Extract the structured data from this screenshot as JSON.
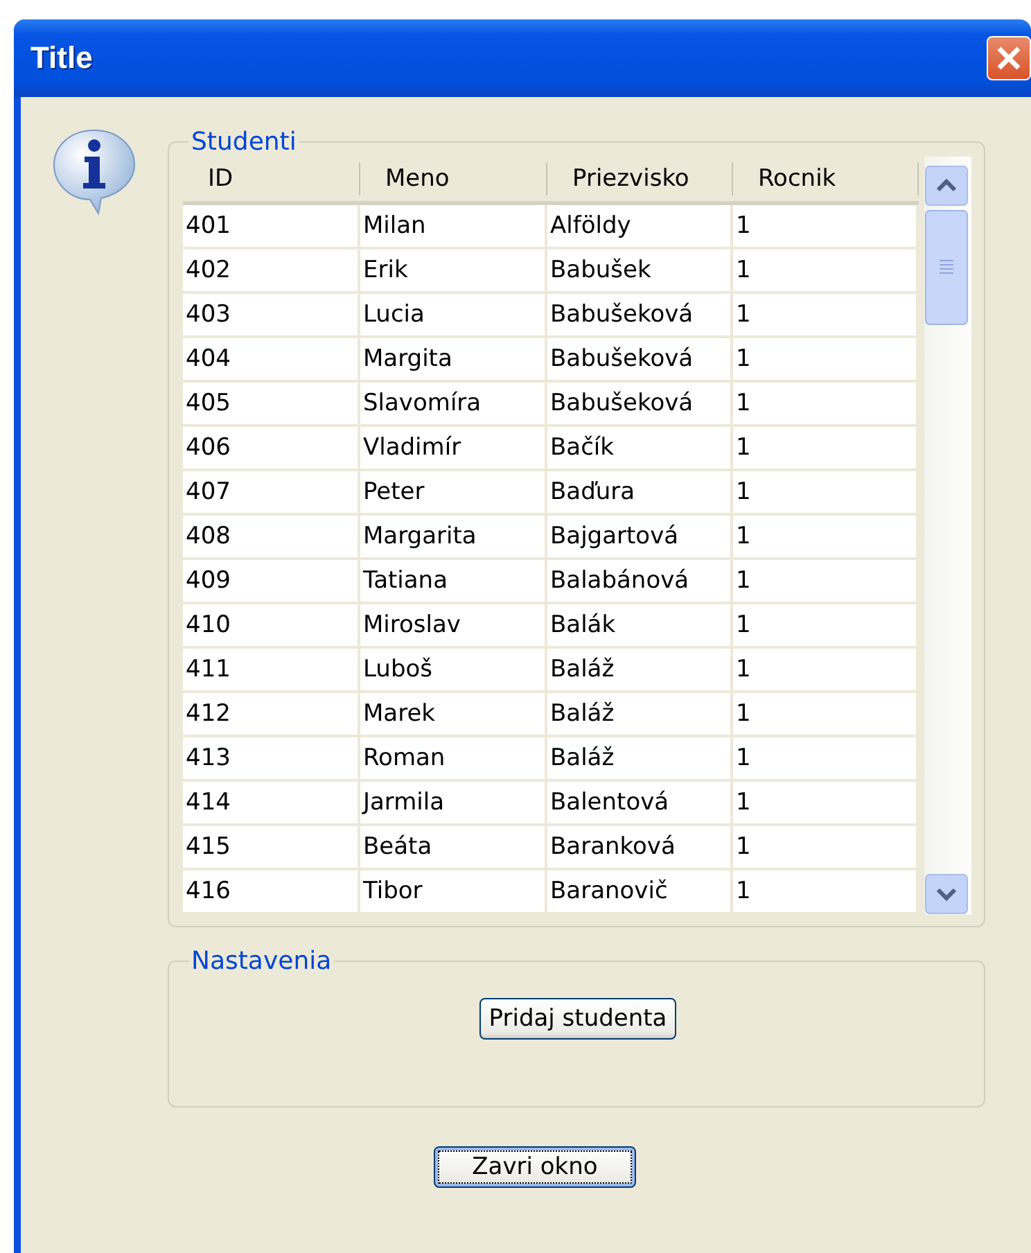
{
  "window": {
    "title": "Title"
  },
  "studenti": {
    "legend": "Studenti",
    "columns": [
      "ID",
      "Meno",
      "Priezvisko",
      "Rocnik"
    ],
    "rows": [
      [
        "401",
        "Milan",
        "Alföldy",
        "1"
      ],
      [
        "402",
        "Erik",
        "Babušek",
        "1"
      ],
      [
        "403",
        "Lucia",
        "Babušeková",
        "1"
      ],
      [
        "404",
        "Margita",
        "Babušeková",
        "1"
      ],
      [
        "405",
        "Slavomíra",
        "Babušeková",
        "1"
      ],
      [
        "406",
        "Vladimír",
        "Bačík",
        "1"
      ],
      [
        "407",
        "Peter",
        "Baďura",
        "1"
      ],
      [
        "408",
        "Margarita",
        "Bajgartová",
        "1"
      ],
      [
        "409",
        "Tatiana",
        "Balabánová",
        "1"
      ],
      [
        "410",
        "Miroslav",
        "Balák",
        "1"
      ],
      [
        "411",
        "Luboš",
        "Baláž",
        "1"
      ],
      [
        "412",
        "Marek",
        "Baláž",
        "1"
      ],
      [
        "413",
        "Roman",
        "Baláž",
        "1"
      ],
      [
        "414",
        "Jarmila",
        "Balentová",
        "1"
      ],
      [
        "415",
        "Beáta",
        "Baranková",
        "1"
      ],
      [
        "416",
        "Tibor",
        "Baranovič",
        "1"
      ]
    ]
  },
  "nastavenia": {
    "legend": "Nastavenia",
    "button": {
      "label": "Pridaj studenta",
      "focused": false
    }
  },
  "close_button": {
    "label": "Zavri okno",
    "focused": true
  }
}
